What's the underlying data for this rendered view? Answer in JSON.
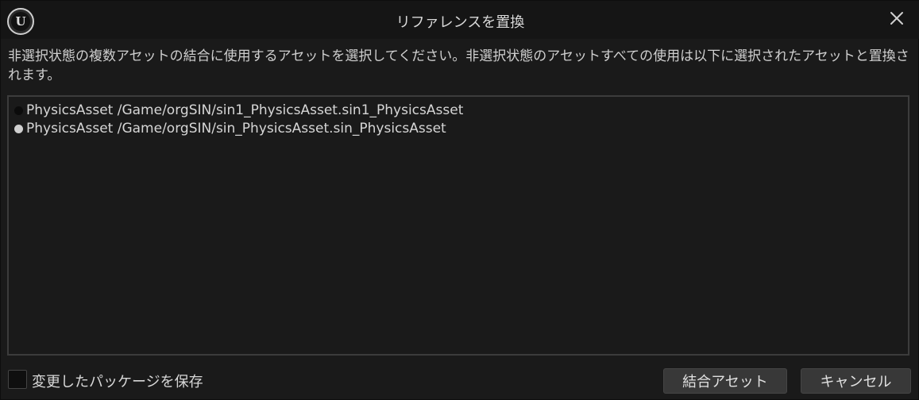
{
  "window": {
    "title": "リファレンスを置換",
    "logo_icon": "unreal-engine-logo",
    "close_icon": "close-icon"
  },
  "description": "非選択状態の複数アセットの結合に使用するアセットを選択してください。非選択状態のアセットすべての使用は以下に選択されたアセットと置換されます。",
  "assets": [
    {
      "label": "PhysicsAsset /Game/orgSIN/sin1_PhysicsAsset.sin1_PhysicsAsset",
      "selected": false
    },
    {
      "label": "PhysicsAsset /Game/orgSIN/sin_PhysicsAsset.sin_PhysicsAsset",
      "selected": true
    }
  ],
  "footer": {
    "save_packages_label": "変更したパッケージを保存",
    "save_packages_checked": false,
    "merge_button_label": "結合アセット",
    "cancel_button_label": "キャンセル"
  }
}
